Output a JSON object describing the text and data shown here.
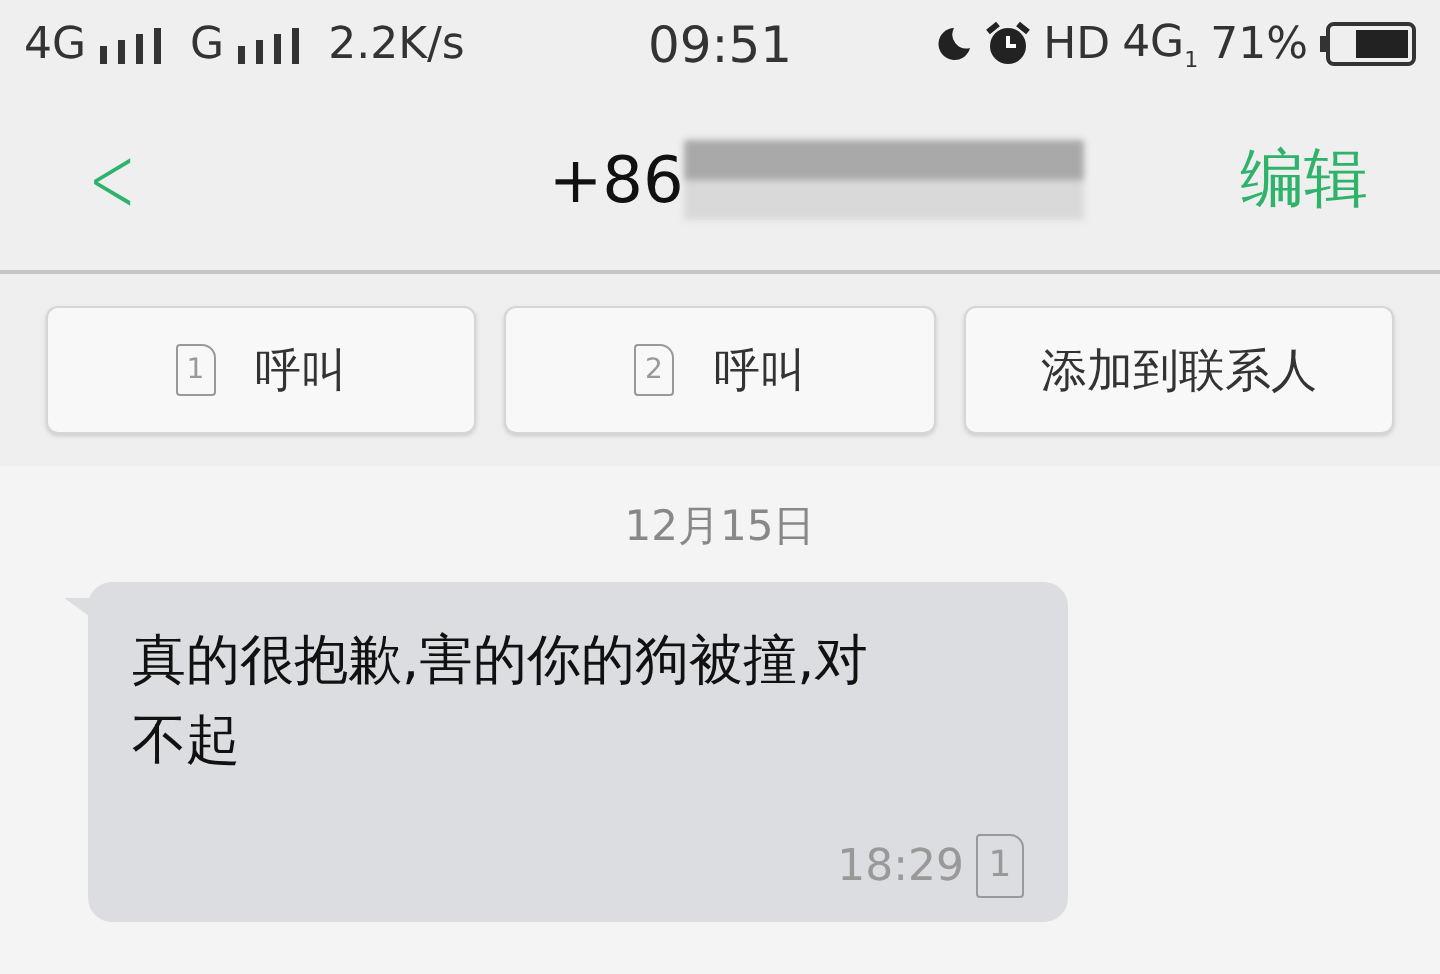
{
  "status_bar": {
    "network_1": "4G",
    "network_2": "G",
    "speed": "2.2K/s",
    "time": "09:51",
    "hd": "HD",
    "network_3": "4G",
    "sim_index": "1",
    "battery": "71%"
  },
  "header": {
    "back": "<",
    "title": "+86",
    "edit": "编辑"
  },
  "actions": [
    {
      "sim": "1",
      "label": "呼叫"
    },
    {
      "sim": "2",
      "label": "呼叫"
    },
    {
      "label": "添加到联系人"
    }
  ],
  "messages": [
    {
      "date": "12月15日",
      "text": "真的很抱歉,害的你的狗被撞,对不起",
      "time": "18:29",
      "sim": "1"
    }
  ]
}
